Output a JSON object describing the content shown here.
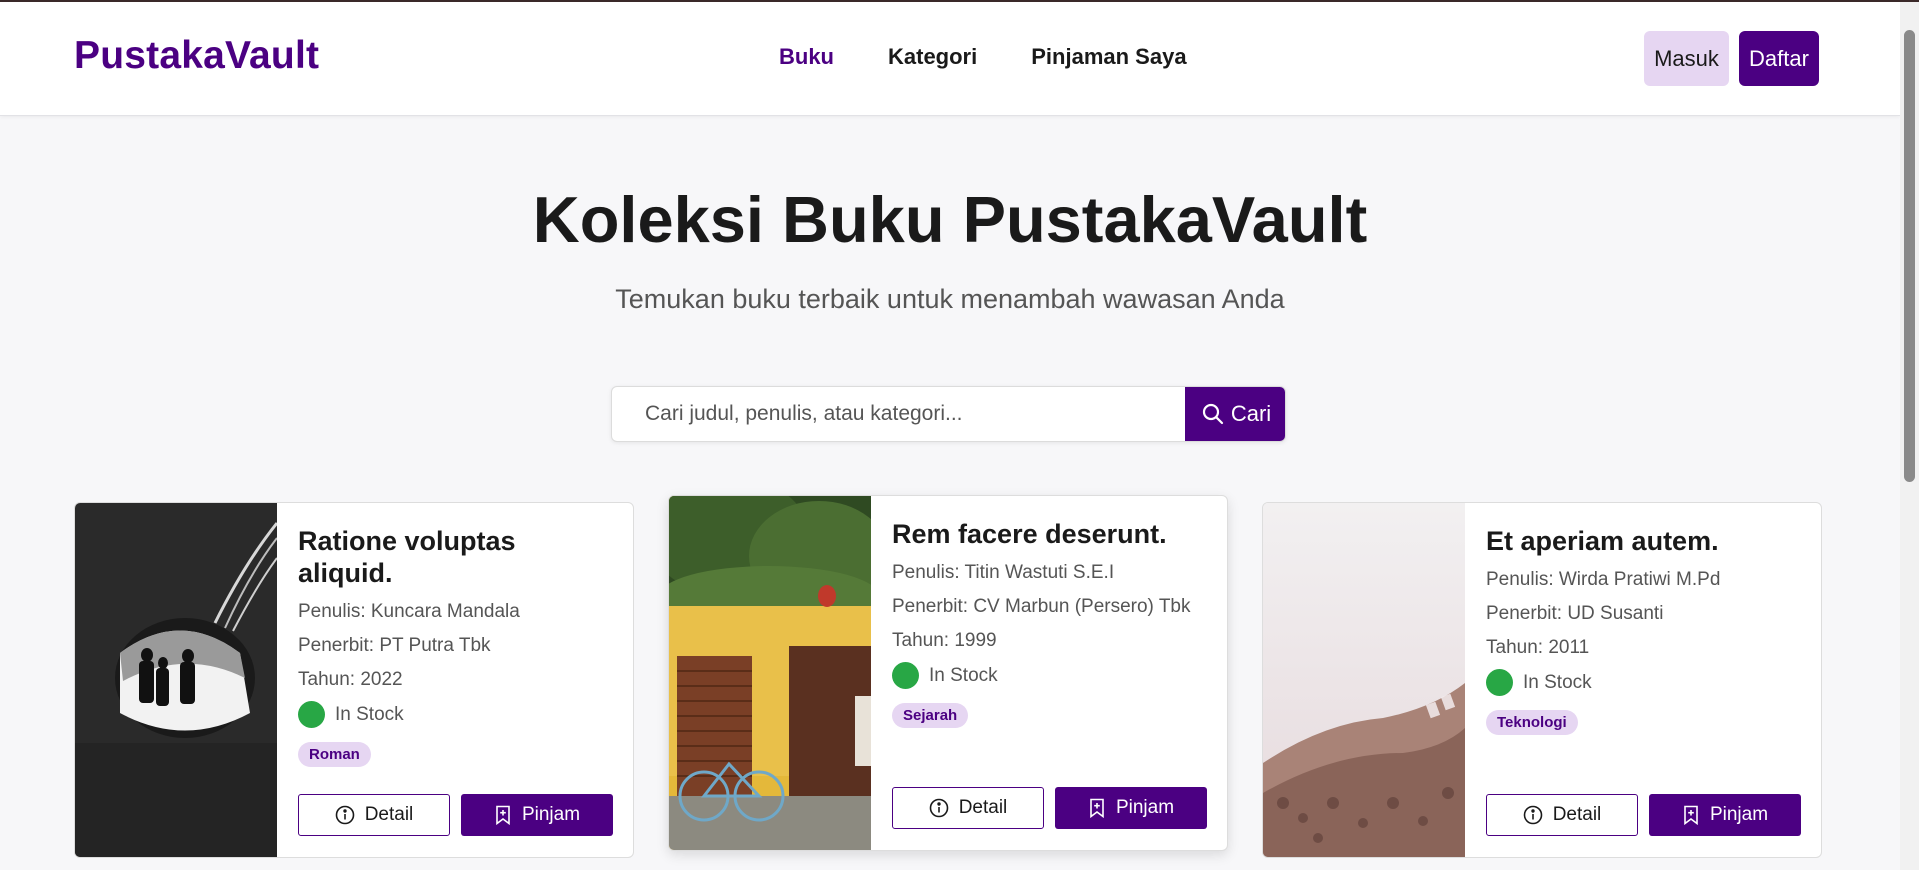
{
  "header": {
    "brand": "PustakaVault",
    "nav": [
      {
        "label": "Buku",
        "active": true
      },
      {
        "label": "Kategori",
        "active": false
      },
      {
        "label": "Pinjaman Saya",
        "active": false
      }
    ],
    "login_label": "Masuk",
    "register_label": "Daftar"
  },
  "hero": {
    "title": "Koleksi Buku PustakaVault",
    "subtitle": "Temukan buku terbaik untuk menambah wawasan Anda"
  },
  "search": {
    "placeholder": "Cari judul, penulis, atau kategori...",
    "value": "",
    "button_label": "Cari",
    "icon": "search-icon"
  },
  "books": [
    {
      "title": "Ratione voluptas aliquid.",
      "author": "Penulis: Kuncara Mandala",
      "publisher": "Penerbit: PT Putra Tbk",
      "year": "Tahun: 2022",
      "stock": "In Stock",
      "category": "Roman",
      "detail_label": "Detail",
      "borrow_label": "Pinjam"
    },
    {
      "title": "Rem facere deserunt.",
      "author": "Penulis: Titin Wastuti S.E.I",
      "publisher": "Penerbit: CV Marbun (Persero) Tbk",
      "year": "Tahun: 1999",
      "stock": "In Stock",
      "category": "Sejarah",
      "detail_label": "Detail",
      "borrow_label": "Pinjam"
    },
    {
      "title": "Et aperiam autem.",
      "author": "Penulis: Wirda Pratiwi M.Pd",
      "publisher": "Penerbit: UD Susanti",
      "year": "Tahun: 2011",
      "stock": "In Stock",
      "category": "Teknologi",
      "detail_label": "Detail",
      "borrow_label": "Pinjam"
    }
  ],
  "colors": {
    "brand": "#4b0082",
    "brand_light": "#e6d6f2",
    "stock_green": "#28a745"
  }
}
